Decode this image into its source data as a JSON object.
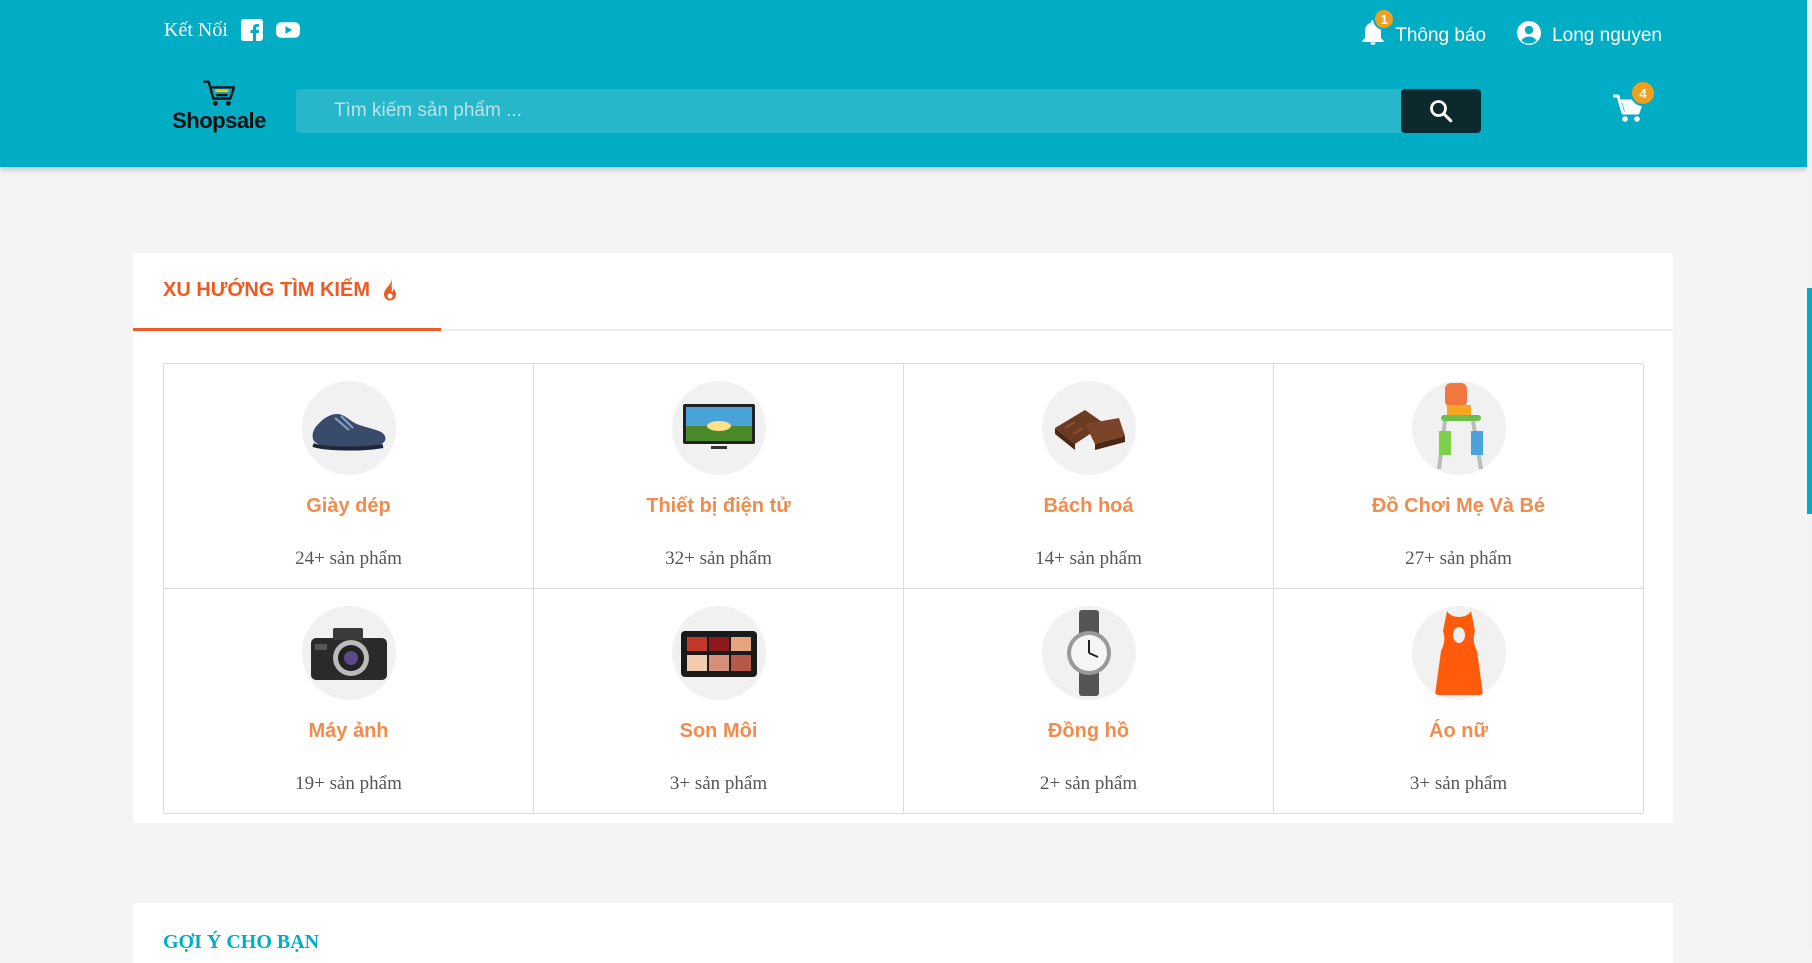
{
  "header": {
    "connect_label": "Kết Nối",
    "notification_label": "Thông báo",
    "notification_count": "1",
    "user_name": "Long nguyen",
    "logo_text": "Shopsale",
    "search_placeholder": "Tìm kiếm sản phẩm ...",
    "cart_count": "4"
  },
  "trending": {
    "title": "XU HƯỚNG TÌM KIẾM",
    "categories": [
      {
        "name": "Giày dép",
        "count": "24+ sản phẩm",
        "icon": "shoe-icon"
      },
      {
        "name": "Thiết bị điện tử",
        "count": "32+ sản phẩm",
        "icon": "tv-icon"
      },
      {
        "name": "Bách hoá",
        "count": "14+ sản phẩm",
        "icon": "chocolate-icon"
      },
      {
        "name": "Đồ Chơi Mẹ Và Bé",
        "count": "27+ sản phẩm",
        "icon": "high-chair-icon"
      },
      {
        "name": "Máy ảnh",
        "count": "19+ sản phẩm",
        "icon": "camera-icon"
      },
      {
        "name": "Son Môi",
        "count": "3+ sản phẩm",
        "icon": "makeup-palette-icon"
      },
      {
        "name": "Đồng hồ",
        "count": "2+ sản phẩm",
        "icon": "watch-icon"
      },
      {
        "name": "Áo nữ",
        "count": "3+ sản phẩm",
        "icon": "dress-icon"
      }
    ]
  },
  "suggest": {
    "title": "GỢI Ý CHO BẠN"
  },
  "colors": {
    "header": "#00adc5",
    "accent": "#ee5a24",
    "category_text": "#f28c4e"
  }
}
